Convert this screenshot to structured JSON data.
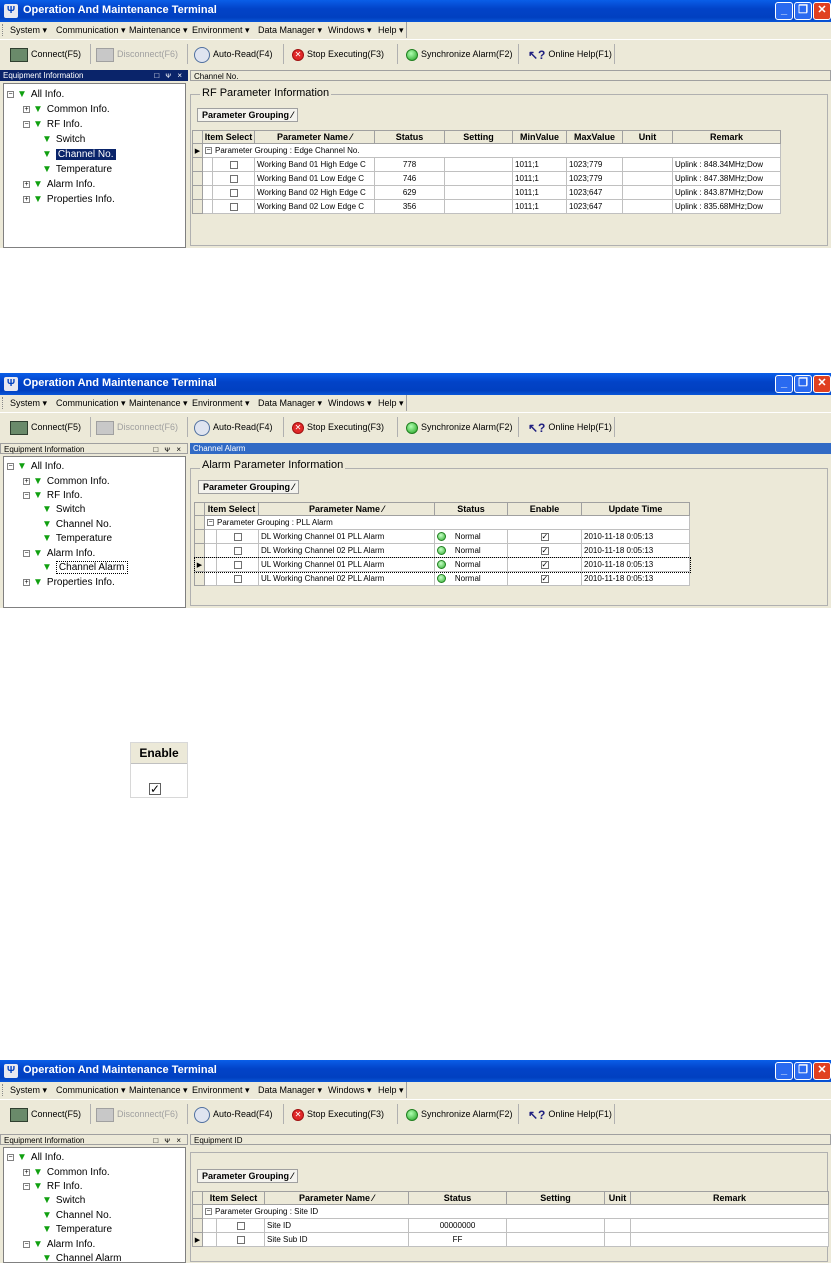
{
  "window": {
    "title": "Operation And Maintenance Terminal",
    "minimize": "_",
    "restore": "❐",
    "close": "✕"
  },
  "menu": [
    "System",
    "Communication",
    "Maintenance",
    "Environment",
    "Data Manager",
    "Windows",
    "Help"
  ],
  "toolbar": {
    "connect": "Connect(F5)",
    "disconnect": "Disconnect(F6)",
    "auto_read": "Auto-Read(F4)",
    "stop": "Stop Executing(F3)",
    "sync": "Synchronize Alarm(F2)",
    "help": "Online Help(F1)"
  },
  "left_panel": {
    "header": "Equipment Information",
    "header_buttons": "□ ᴪ ×"
  },
  "tree": {
    "all": "All Info.",
    "common": "Common Info.",
    "rf": "RF Info.",
    "switch": "Switch",
    "channel": "Channel No.",
    "temperature": "Temperature",
    "alarm": "Alarm Info.",
    "channel_alarm": "Channel Alarm",
    "properties": "Properties Info."
  },
  "screen1": {
    "tab": "Channel No.",
    "group_title": "RF Parameter Information",
    "grouping_btn": "Parameter Grouping",
    "columns": [
      "Item Select",
      "Parameter Name",
      "Status",
      "Setting",
      "MinValue",
      "MaxValue",
      "Unit",
      "Remark"
    ],
    "group_label": "Parameter Grouping : Edge Channel No.",
    "rows": [
      {
        "name": "Working Band 01 High Edge C",
        "status": "778",
        "setting": "",
        "min": "1011;1",
        "max": "1023;779",
        "unit": "",
        "remark": "Uplink : 848.34MHz;Dow"
      },
      {
        "name": "Working Band 01 Low Edge C",
        "status": "746",
        "setting": "",
        "min": "1011;1",
        "max": "1023;779",
        "unit": "",
        "remark": "Uplink : 847.38MHz;Dow"
      },
      {
        "name": "Working Band 02 High Edge C",
        "status": "629",
        "setting": "",
        "min": "1011;1",
        "max": "1023;647",
        "unit": "",
        "remark": "Uplink : 843.87MHz;Dow"
      },
      {
        "name": "Working Band 02 Low Edge C",
        "status": "356",
        "setting": "",
        "min": "1011;1",
        "max": "1023;647",
        "unit": "",
        "remark": "Uplink : 835.68MHz;Dow"
      }
    ]
  },
  "screen2": {
    "tab": "Channel Alarm",
    "group_title": "Alarm Parameter Information",
    "grouping_btn": "Parameter Grouping",
    "columns": [
      "Item Select",
      "Parameter Name",
      "Status",
      "Enable",
      "Update Time"
    ],
    "group_label": "Parameter Grouping : PLL Alarm",
    "rows": [
      {
        "name": "DL Working Channel 01 PLL Alarm",
        "status": "Normal",
        "time": "2010-11-18 0:05:13"
      },
      {
        "name": "DL Working Channel 02 PLL Alarm",
        "status": "Normal",
        "time": "2010-11-18 0:05:13"
      },
      {
        "name": "UL Working Channel 01 PLL Alarm",
        "status": "Normal",
        "time": "2010-11-18 0:05:13"
      },
      {
        "name": "UL Working Channel 02 PLL Alarm",
        "status": "Normal",
        "time": "2010-11-18 0:05:13"
      }
    ]
  },
  "zoom": {
    "header": "Enable"
  },
  "screen3": {
    "tab": "Equipment ID",
    "grouping_btn": "Parameter Grouping",
    "columns": [
      "Item Select",
      "Parameter Name",
      "Status",
      "Setting",
      "Unit",
      "Remark"
    ],
    "group_label": "Parameter Grouping : Site ID",
    "rows": [
      {
        "name": "Site ID",
        "status": "00000000",
        "setting": "",
        "unit": "",
        "remark": ""
      },
      {
        "name": "Site Sub ID",
        "status": "FF",
        "setting": "",
        "unit": "",
        "remark": ""
      }
    ]
  },
  "colors": {
    "titlebar": "#0243c8",
    "selection": "#0a246a",
    "tab_active": "#316ac5",
    "status_led": "#30b030"
  }
}
